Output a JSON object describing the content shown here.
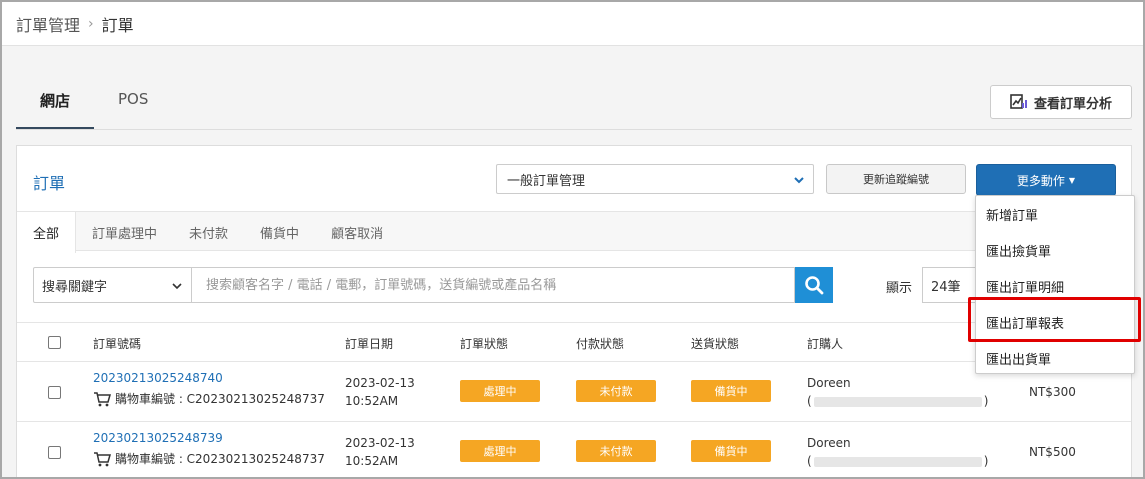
{
  "breadcrumb": {
    "parent": "訂單管理",
    "separator": "›",
    "current": "訂單"
  },
  "top_tabs": [
    {
      "label": "網店",
      "active": true
    },
    {
      "label": "POS",
      "active": false
    }
  ],
  "analysis_button": {
    "label": "查看訂單分析",
    "icon": "chart-icon"
  },
  "panel": {
    "title": "訂單",
    "mode_select": {
      "value": "一般訂單管理"
    },
    "track_button": "更新追蹤編號",
    "more_button": "更多動作",
    "accent_color": "#1f6fb5"
  },
  "status_tabs": [
    {
      "label": "全部",
      "active": true
    },
    {
      "label": "訂單處理中",
      "active": false
    },
    {
      "label": "未付款",
      "active": false
    },
    {
      "label": "備貨中",
      "active": false
    },
    {
      "label": "顧客取消",
      "active": false
    }
  ],
  "search": {
    "type_value": "搜尋關鍵字",
    "placeholder": "搜索顧客名字 / 電話 / 電郵，訂單號碼，送貨編號或產品名稱",
    "show_label": "顯示",
    "page_size": "24筆"
  },
  "table": {
    "headers": [
      "訂單號碼",
      "訂單日期",
      "訂單狀態",
      "付款狀態",
      "送貨狀態",
      "訂購人"
    ],
    "rows": [
      {
        "order_no": "20230213025248740",
        "cart_label": "購物車編號 : C20230213025248737",
        "date": "2023-02-13",
        "time": "10:52AM",
        "order_status": "處理中",
        "payment_status": "未付款",
        "shipping_status": "備貨中",
        "customer": "Doreen",
        "paren_open": "(",
        "paren_close": ")",
        "amount": "NT$300"
      },
      {
        "order_no": "20230213025248739",
        "cart_label": "購物車編號 : C20230213025248737",
        "date": "2023-02-13",
        "time": "10:52AM",
        "order_status": "處理中",
        "payment_status": "未付款",
        "shipping_status": "備貨中",
        "customer": "Doreen",
        "paren_open": "(",
        "paren_close": ")",
        "amount": "NT$500"
      }
    ]
  },
  "dropdown": {
    "items": [
      "新增訂單",
      "匯出撿貨單",
      "匯出訂單明細",
      "匯出訂單報表",
      "匯出出貨單"
    ],
    "highlighted_index": 3,
    "highlight_color": "#e00000"
  }
}
